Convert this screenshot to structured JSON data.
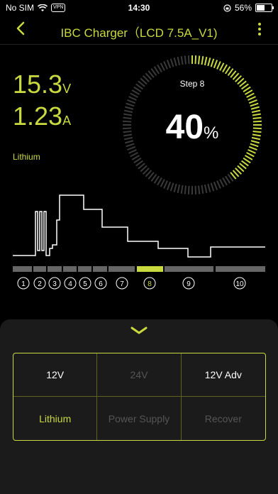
{
  "status": {
    "carrier": "No SIM",
    "vpn": "VPN",
    "time": "14:30",
    "battery": "56%",
    "battery_level": 0.56
  },
  "header": {
    "title": "IBC Charger（LCD 7.5A_V1)"
  },
  "readings": {
    "voltage": "15.3",
    "voltage_unit": "V",
    "current": "1.23",
    "current_unit": "A",
    "battery_type": "Lithium"
  },
  "progress": {
    "step_label": "Step 8",
    "percent": "40",
    "percent_sign": "%",
    "fraction": 0.4
  },
  "steps": {
    "labels": [
      "1",
      "2",
      "3",
      "4",
      "5",
      "6",
      "7",
      "8",
      "9",
      "10"
    ],
    "active_index": 7
  },
  "colors": {
    "accent": "#c9d940",
    "inactive": "#555555",
    "bar": "#666666"
  },
  "modes": {
    "r1": [
      "12V",
      "24V",
      "12V Adv"
    ],
    "r2": [
      "Lithium",
      "Power Supply",
      "Recover"
    ]
  },
  "icons": {
    "back": "chevron-left-icon",
    "menu": "more-vertical-icon",
    "collapse": "chevron-down-icon"
  }
}
